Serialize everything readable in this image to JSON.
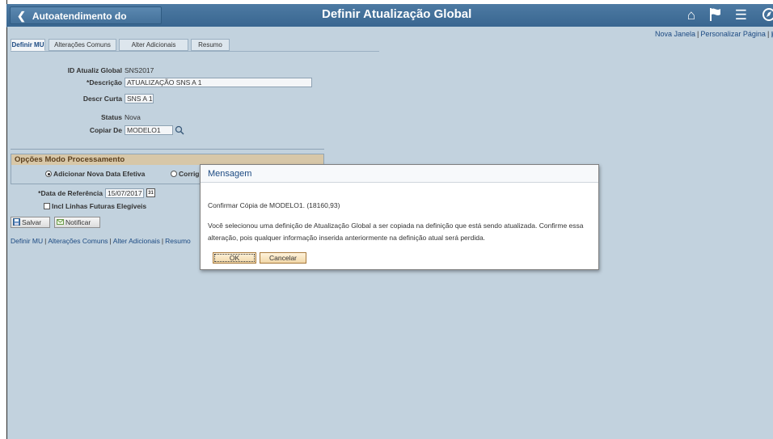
{
  "header": {
    "back_label": "Autoatendimento do Gerente",
    "title": "Definir Atualização Global"
  },
  "util_links": {
    "new_window": "Nova Janela",
    "personalize": "Personalizar Página"
  },
  "tabs": [
    {
      "label": "Definir MU"
    },
    {
      "label": "Alterações Comuns"
    },
    {
      "label": "Alter Adicionais"
    },
    {
      "label": "Resumo"
    }
  ],
  "form": {
    "id_label": "ID Atualiz Global",
    "id_value": "SNS2017",
    "descricao_label": "*Descrição",
    "descricao_value": "ATUALIZAÇÃO SNS A 1",
    "descr_curta_label": "Descr Curta",
    "descr_curta_value": "SNS A 1",
    "status_label": "Status",
    "status_value": "Nova",
    "copiar_label": "Copiar De",
    "copiar_value": "MODELO1"
  },
  "options": {
    "title": "Opções Modo Processamento",
    "radio1_label": "Adicionar Nova Data Efetiva",
    "radio2_label": "Corrig"
  },
  "ref": {
    "date_label": "*Data de Referência",
    "date_value": "15/07/2017",
    "calendar_icon_text": "31",
    "include_label": "Incl Linhas Futuras Elegíveis"
  },
  "buttons": {
    "save": "Salvar",
    "notify": "Notificar"
  },
  "bottom_links": [
    "Definir MU",
    "Alterações Comuns",
    "Alter Adicionais",
    "Resumo"
  ],
  "dialog": {
    "title": "Mensagem",
    "line1": "Confirmar Cópia de MODELO1. (18160,93)",
    "line2": "Você selecionou uma definição de Atualização Global a ser copiada na definição que está sendo atualizada. Confirme essa",
    "line3": "alteração, pois qualquer informação inserida anteriormente na definição atual será perdida.",
    "ok": "OK",
    "cancel": "Cancelar"
  },
  "colors": {
    "header": "#3f6c95",
    "content_bg": "#c2d2de",
    "group_title_bg": "#d7c7a8"
  },
  "icons": [
    "chevron-left-icon",
    "home-icon",
    "flag-icon",
    "menu-icon",
    "compass-icon",
    "lookup-icon",
    "calendar-icon",
    "save-icon",
    "notify-icon"
  ]
}
